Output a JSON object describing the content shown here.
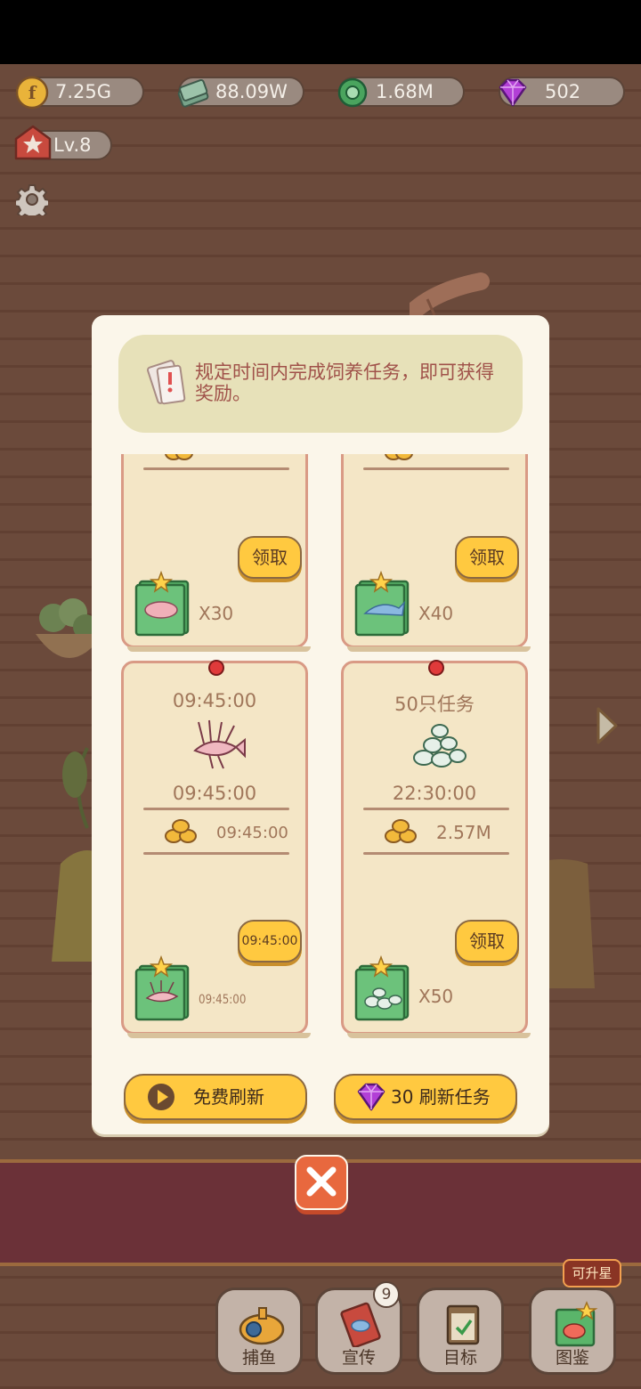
{
  "colors": {
    "wood": "#7b5646",
    "modal_bg": "#fbf6ea",
    "card_bg": "#f4e6c6",
    "button_yellow": "#ffc940",
    "banner_text": "#a0524a",
    "band_red": "#6b3138"
  },
  "resources": {
    "gold": {
      "icon": "gold-coin-icon",
      "value": "7.25G"
    },
    "cash": {
      "icon": "cash-stack-icon",
      "value": "88.09W"
    },
    "feed": {
      "icon": "green-feed-icon",
      "value": "1.68M"
    },
    "gems": {
      "icon": "purple-gem-icon",
      "value": "502"
    }
  },
  "level": {
    "icon": "level-star-icon",
    "value": "Lv.8"
  },
  "modal": {
    "banner_text": "规定时间内完成饲养任务，即可获得奖励。",
    "cards": [
      {
        "claim_label": "领取",
        "qty": "X30",
        "item_icon": "fish-book-icon"
      },
      {
        "claim_label": "领取",
        "qty": "X40",
        "item_icon": "fish-book-icon"
      },
      {
        "header": "09:45:00",
        "timer": "09:45:00",
        "reward": "09:45:00",
        "button": "09:45:00",
        "qty": "09:45:00",
        "item_icon": "lionfish-icon"
      },
      {
        "header": "50只任务",
        "timer": "22:30:00",
        "reward": "2.57M",
        "button": "领取",
        "qty": "X50",
        "item_icon": "white-food-icon"
      }
    ],
    "free_refresh_label": "免费刷新",
    "gem_refresh_label": "30 刷新任务"
  },
  "bottom_nav": [
    {
      "label": "捕鱼",
      "icon": "submarine-icon"
    },
    {
      "label": "宣传",
      "icon": "flyer-icon",
      "badge": "9"
    },
    {
      "label": "目标",
      "icon": "clipboard-icon"
    },
    {
      "label": "图鉴",
      "icon": "album-icon",
      "tag": "可升星"
    }
  ]
}
